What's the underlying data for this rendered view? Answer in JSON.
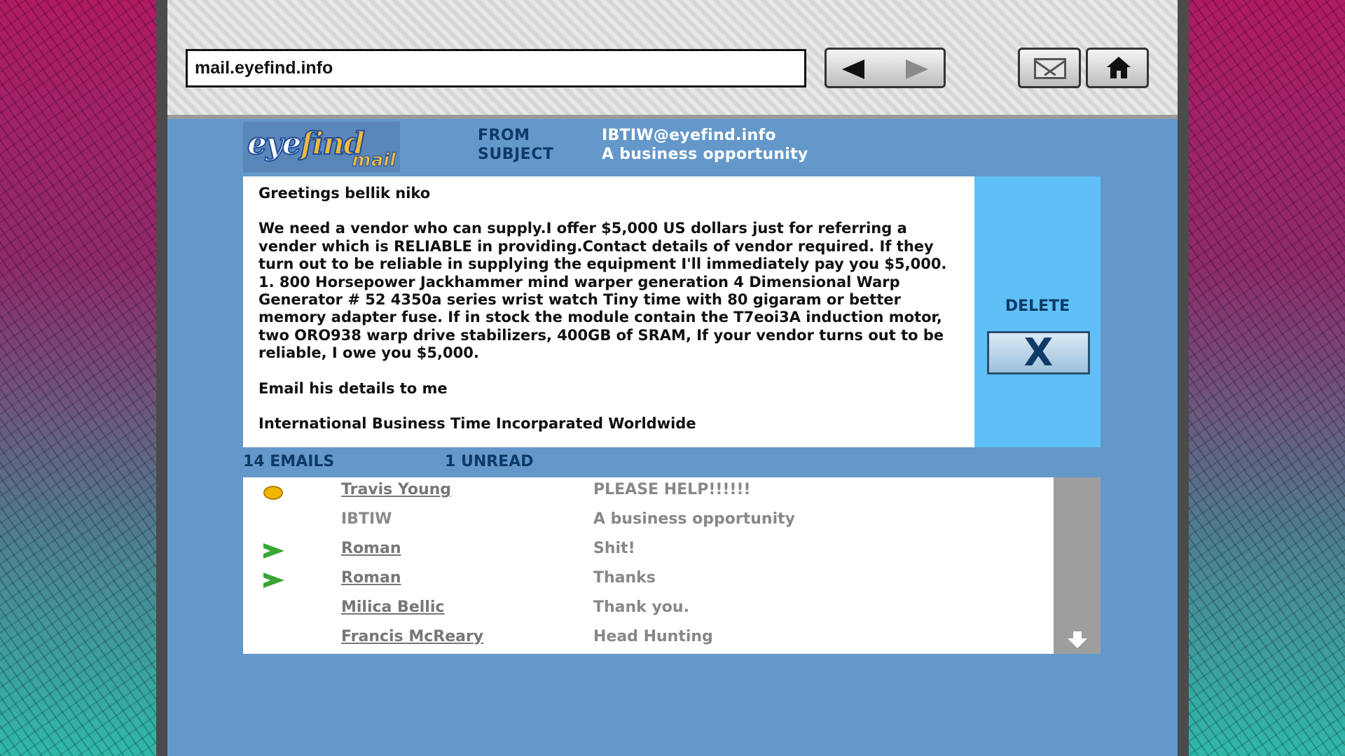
{
  "browser": {
    "url": "mail.eyefind.info"
  },
  "logo": {
    "eye": "eye",
    "find": "find",
    "mail": "mail"
  },
  "header": {
    "from_label": "FROM",
    "subject_label": "SUBJECT",
    "from_value": "IBTIW@eyefind.info",
    "subject_value": "A business opportunity"
  },
  "message": {
    "greeting": "Greetings bellik niko",
    "body": "We need a vendor who can supply.I offer $5,000 US dollars just for referring a vender which is RELIABLE in providing.Contact details of vendor required. If they turn out to be reliable in supplying the equipment I'll immediately pay you $5,000. 1. 800 Horsepower Jackhammer mind warper generation 4 Dimensional Warp Generator # 52 4350a series wrist watch Tiny time with 80 gigaram or better memory adapter fuse. If in stock the module contain the T7eoi3A induction motor, two ORO938 warp drive stabilizers, 400GB of SRAM, If your vendor turns out to be reliable, I owe you $5,000.",
    "line3": "Email his details to me",
    "signature": "International Business Time Incorparated Worldwide"
  },
  "actions": {
    "delete_label": "DELETE",
    "delete_icon": "X"
  },
  "inbox": {
    "email_count": "14 EMAILS",
    "unread_count": "1 UNREAD",
    "rows": [
      {
        "sender": "Travis Young",
        "subject": "PLEASE HELP!!!!!!",
        "status": "unread-dot"
      },
      {
        "sender": "IBTIW",
        "subject": "A business opportunity",
        "status": "none"
      },
      {
        "sender": "Roman",
        "subject": "Shit!",
        "status": "replied-arrow"
      },
      {
        "sender": "Roman",
        "subject": "Thanks",
        "status": "replied-arrow"
      },
      {
        "sender": "Milica Bellic",
        "subject": "Thank you.",
        "status": "none"
      },
      {
        "sender": "Francis McReary",
        "subject": "Head Hunting",
        "status": "none"
      }
    ]
  },
  "colors": {
    "page_bg": "#6598ca",
    "accent": "#5ec0f6",
    "label": "#0d3a66"
  }
}
